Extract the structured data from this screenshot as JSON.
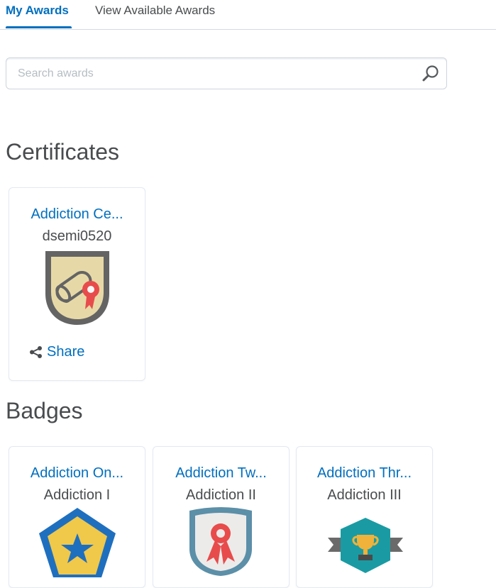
{
  "tabs": {
    "my_awards": "My Awards",
    "view_available": "View Available Awards"
  },
  "search": {
    "placeholder": "Search awards"
  },
  "certificates": {
    "heading": "Certificates",
    "items": [
      {
        "title": "Addiction Ce...",
        "subtitle": "dsemi0520",
        "share_label": "Share"
      }
    ]
  },
  "badges": {
    "heading": "Badges",
    "items": [
      {
        "title": "Addiction On...",
        "subtitle": "Addiction I"
      },
      {
        "title": "Addiction Tw...",
        "subtitle": "Addiction II"
      },
      {
        "title": "Addiction Thr...",
        "subtitle": "Addiction III"
      }
    ]
  },
  "colors": {
    "accent": "#006fbf",
    "underline": "#006fbf"
  },
  "icons": {
    "search": "search-icon",
    "share": "share-icon"
  }
}
